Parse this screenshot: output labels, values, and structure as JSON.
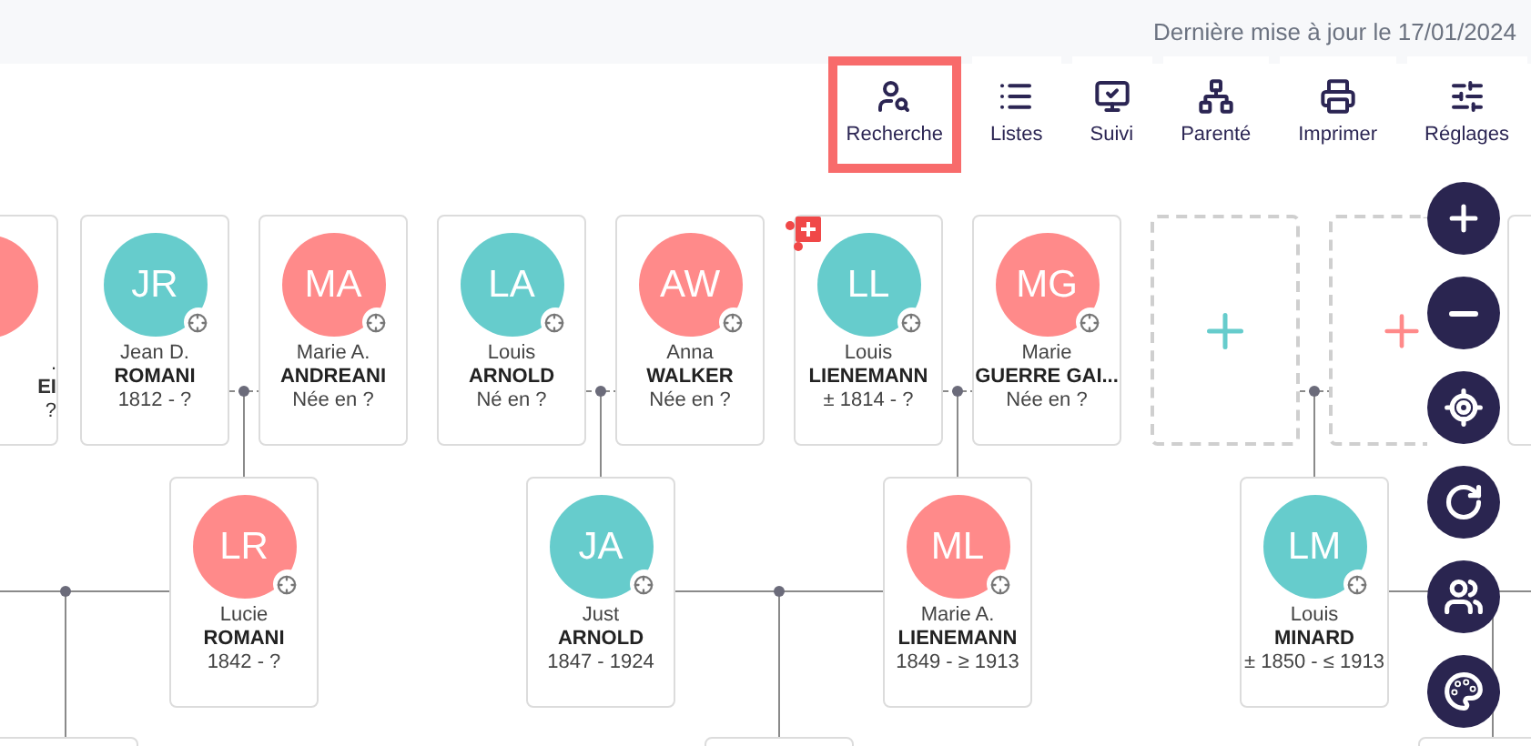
{
  "header": {
    "last_update": "Dernière mise à jour le 17/01/2024"
  },
  "toolbar": [
    {
      "kind": "search",
      "label": "Recherche",
      "selected": true
    },
    {
      "kind": "lists",
      "label": "Listes",
      "selected": false
    },
    {
      "kind": "follow",
      "label": "Suivi",
      "selected": false
    },
    {
      "kind": "kinship",
      "label": "Parenté",
      "selected": false
    },
    {
      "kind": "print",
      "label": "Imprimer",
      "selected": false
    },
    {
      "kind": "settings",
      "label": "Réglages",
      "selected": false
    }
  ],
  "people": [
    {
      "kind": "cut",
      "first_name": ".",
      "last_name": "EI",
      "dates": "?",
      "color": "#ff8a8a"
    },
    {
      "kind": "card",
      "initials": "JR",
      "first_name": "Jean D.",
      "last_name": "ROMANI",
      "dates": "1812 - ?",
      "color": "#66cccc",
      "badge": false
    },
    {
      "kind": "card",
      "initials": "MA",
      "first_name": "Marie A.",
      "last_name": "ANDREANI",
      "dates": "Née en ?",
      "color": "#ff8a8a",
      "badge": false
    },
    {
      "kind": "card",
      "initials": "LA",
      "first_name": "Louis",
      "last_name": "ARNOLD",
      "dates": "Né en ?",
      "color": "#66cccc",
      "badge": false
    },
    {
      "kind": "card",
      "initials": "AW",
      "first_name": "Anna",
      "last_name": "WALKER",
      "dates": "Née en ?",
      "color": "#ff8a8a",
      "badge": false
    },
    {
      "kind": "card",
      "initials": "LL",
      "first_name": "Louis",
      "last_name": "LIENEMANN",
      "dates": "± 1814 - ?",
      "color": "#66cccc",
      "badge": true
    },
    {
      "kind": "card",
      "initials": "MG",
      "first_name": "Marie",
      "last_name": "GUERRE GAI...",
      "dates": "Née en ?",
      "color": "#ff8a8a",
      "badge": false
    },
    {
      "kind": "card",
      "initials": "LR",
      "first_name": "Lucie",
      "last_name": "ROMANI",
      "dates": "1842 - ?",
      "color": "#ff8a8a",
      "badge": false
    },
    {
      "kind": "card",
      "initials": "JA",
      "first_name": "Just",
      "last_name": "ARNOLD",
      "dates": "1847 - 1924",
      "color": "#66cccc",
      "badge": false
    },
    {
      "kind": "card",
      "initials": "ML",
      "first_name": "Marie A.",
      "last_name": "LIENEMANN",
      "dates": "1849 - ≥ 1913",
      "color": "#ff8a8a",
      "badge": false
    },
    {
      "kind": "card",
      "initials": "LM",
      "first_name": "Louis",
      "last_name": "MINARD",
      "dates": "± 1850 - ≤ 1913",
      "color": "#66cccc",
      "badge": false
    }
  ],
  "add_slots": [
    {
      "color": "#66cccc"
    },
    {
      "color": "#ff8a8a"
    }
  ],
  "controls": [
    {
      "kind": "zoom-in"
    },
    {
      "kind": "zoom-out"
    },
    {
      "kind": "center"
    },
    {
      "kind": "refresh"
    },
    {
      "kind": "family"
    },
    {
      "kind": "palette"
    }
  ]
}
